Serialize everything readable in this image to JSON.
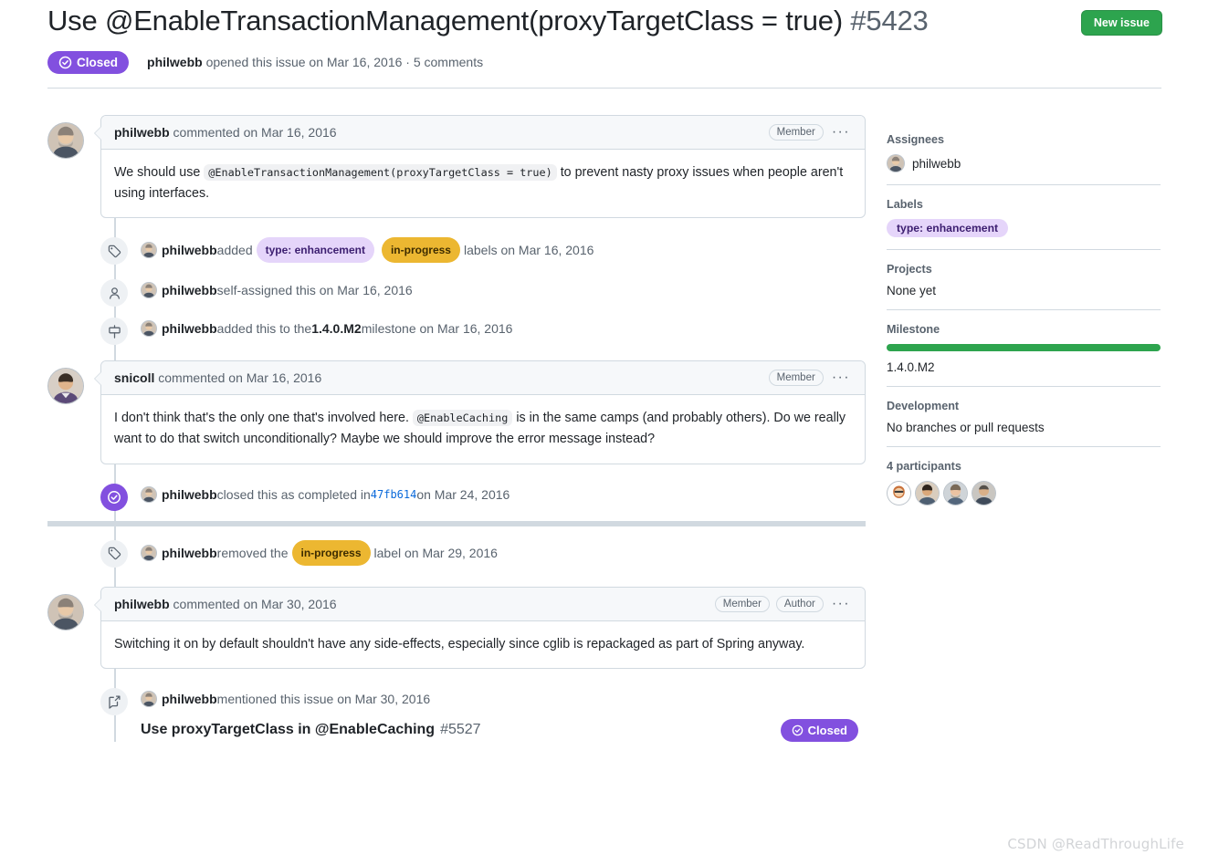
{
  "header": {
    "title": "Use @EnableTransactionManagement(proxyTargetClass = true)",
    "number": "#5423",
    "new_issue_label": "New issue",
    "state": "Closed",
    "meta_author": "philwebb",
    "meta_text": " opened this issue on Mar 16, 2016 · 5 comments"
  },
  "timeline": {
    "comment1": {
      "author": "philwebb",
      "action": " commented on Mar 16, 2016",
      "role": "Member",
      "kebab": "···",
      "body_pre": "We should use ",
      "body_code": "@EnableTransactionManagement(proxyTargetClass = true)",
      "body_post": " to prevent nasty proxy issues when people aren't using interfaces."
    },
    "event_labels": {
      "icon": "tag-icon",
      "author": "philwebb",
      "verb": " added ",
      "label1": "type: enhancement",
      "label2": "in-progress",
      "suffix": " labels on Mar 16, 2016"
    },
    "event_assign": {
      "icon": "person-icon",
      "author": "philwebb",
      "text": " self-assigned this on Mar 16, 2016"
    },
    "event_milestone": {
      "icon": "milestone-icon",
      "author": "philwebb",
      "pre": " added this to the ",
      "milestone": "1.4.0.M2",
      "post": " milestone on Mar 16, 2016"
    },
    "comment2": {
      "author": "snicoll",
      "action": " commented on Mar 16, 2016",
      "role": "Member",
      "kebab": "···",
      "body_pre": "I don't think that's the only one that's involved here. ",
      "body_code": "@EnableCaching",
      "body_post": " is in the same camps (and probably others). Do we really want to do that switch unconditionally? Maybe we should improve the error message instead?"
    },
    "event_closed": {
      "icon": "issue-closed-icon",
      "author": "philwebb",
      "pre": " closed this as completed in ",
      "sha": "47fb614",
      "post": " on Mar 24, 2016"
    },
    "event_removed": {
      "icon": "tag-icon",
      "author": "philwebb",
      "pre": " removed the ",
      "label": "in-progress",
      "post": " label on Mar 29, 2016"
    },
    "comment3": {
      "author": "philwebb",
      "action": " commented on Mar 30, 2016",
      "role1": "Member",
      "role2": "Author",
      "kebab": "···",
      "body": "Switching it on by default shouldn't have any side-effects, especially since cglib is repackaged as part of Spring anyway."
    },
    "event_mention": {
      "icon": "cross-reference-icon",
      "author": "philwebb",
      "text": " mentioned this issue on Mar 30, 2016",
      "ref_title": "Use proxyTargetClass in @EnableCaching",
      "ref_number": "#5527",
      "ref_state": "Closed"
    }
  },
  "sidebar": {
    "assignees_title": "Assignees",
    "assignee": "philwebb",
    "labels_title": "Labels",
    "label": "type: enhancement",
    "projects_title": "Projects",
    "projects_value": "None yet",
    "milestone_title": "Milestone",
    "milestone_value": "1.4.0.M2",
    "milestone_progress": "100",
    "development_title": "Development",
    "development_value": "No branches or pull requests",
    "participants_title": "4 participants"
  },
  "watermark": "CSDN @ReadThroughLife",
  "colors": {
    "purple": "#8250df",
    "green": "#2da44e",
    "label_enhancement_bg": "#e5d5fa",
    "label_inprogress_bg": "#ecb731",
    "link_blue": "#0969da"
  }
}
